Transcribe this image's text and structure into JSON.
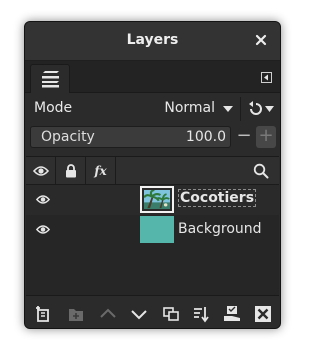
{
  "dialog": {
    "title": "Layers",
    "close_icon": "close-icon"
  },
  "tabs": {
    "active_icon": "layers-stack-icon",
    "menu_icon": "tab-menu-icon"
  },
  "mode": {
    "label": "Mode",
    "value": "Normal",
    "reset_icon": "reset-icon"
  },
  "opacity": {
    "label": "Opacity",
    "value": "100.0",
    "decrement": "−",
    "increment": "+"
  },
  "list_header": {
    "icons": [
      "visibility-eye-icon",
      "lock-icon",
      "effects-fx-icon",
      "search-icon"
    ],
    "fx_label": "fx"
  },
  "layers": [
    {
      "name": "Cocotiers",
      "selected": true,
      "visible": true
    },
    {
      "name": "Background",
      "selected": false,
      "visible": true
    }
  ],
  "colors": {
    "background_layer": "#55b6ab",
    "panel": "#2b2b2b"
  },
  "bottom_toolbar": [
    "new-layer-icon",
    "new-layer-group-icon",
    "raise-layer-icon",
    "lower-layer-icon",
    "duplicate-layer-icon",
    "merge-layer-icon",
    "anchor-layer-icon",
    "delete-layer-icon"
  ]
}
